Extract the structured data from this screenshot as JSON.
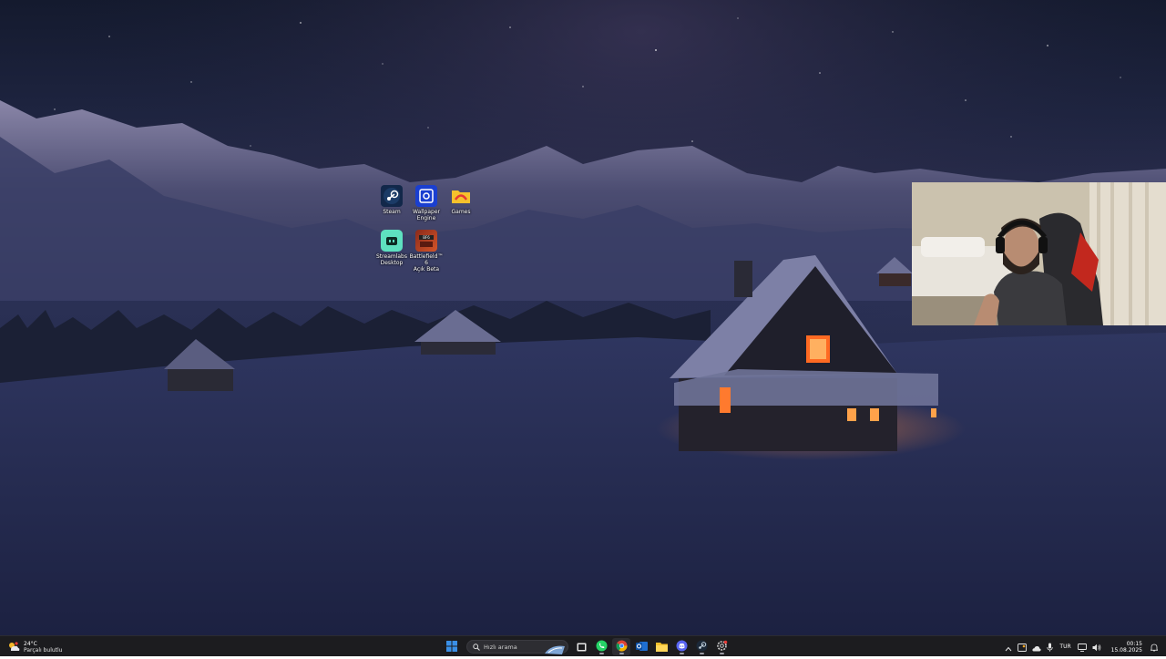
{
  "desktop": {
    "icons": [
      {
        "label": "Steam",
        "icon": "steam-icon"
      },
      {
        "label": "Wallpaper\nEngine",
        "icon": "wallpaper-engine-icon"
      },
      {
        "label": "Games",
        "icon": "folder-icon"
      },
      {
        "label": "Streamlabs\nDesktop",
        "icon": "streamlabs-icon"
      },
      {
        "label": "Battlefield™ 6\nAçık Beta",
        "icon": "battlefield-icon"
      }
    ]
  },
  "taskbar": {
    "weather": {
      "temp": "24°C",
      "condition": "Parçalı bulutlu",
      "icon": "weather-partly-cloudy-icon"
    },
    "search": {
      "placeholder": "Hızlı arama"
    },
    "apps": [
      {
        "name": "start",
        "icon": "windows-start-icon"
      },
      {
        "name": "task-view",
        "icon": "task-view-icon"
      },
      {
        "name": "whatsapp",
        "icon": "whatsapp-icon"
      },
      {
        "name": "chrome",
        "icon": "chrome-icon"
      },
      {
        "name": "outlook",
        "icon": "outlook-icon"
      },
      {
        "name": "file-explorer",
        "icon": "folder-icon"
      },
      {
        "name": "discord",
        "icon": "discord-icon"
      },
      {
        "name": "steam",
        "icon": "steam-icon"
      },
      {
        "name": "settings",
        "icon": "gear-icon"
      }
    ],
    "tray": {
      "language": "TUR",
      "time": "00:15",
      "date": "15.08.2025"
    }
  },
  "colors": {
    "taskbar_bg": "#1c1c1f",
    "accent_blue": "#3a8fe6",
    "window_glow": "#ff7a2e"
  }
}
